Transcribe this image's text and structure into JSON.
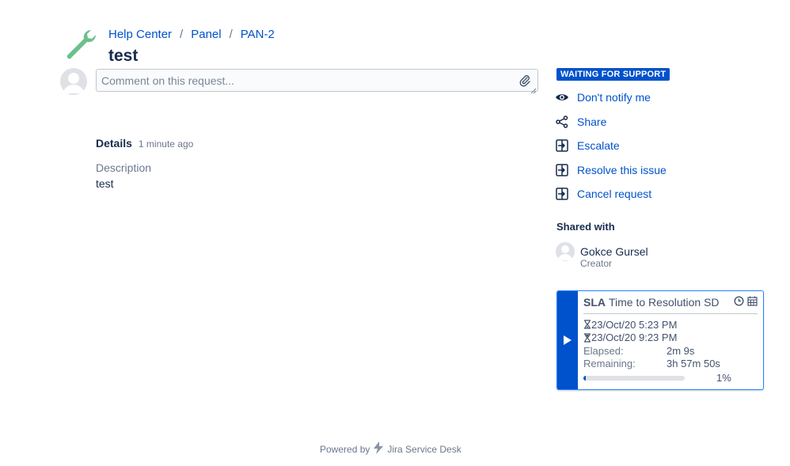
{
  "breadcrumb": {
    "items": [
      "Help Center",
      "Panel",
      "PAN-2"
    ],
    "separator": "/"
  },
  "page_title": "test",
  "comment": {
    "placeholder": "Comment on this request..."
  },
  "details": {
    "title": "Details",
    "time": "1 minute ago",
    "description_label": "Description",
    "description_value": "test"
  },
  "status": {
    "label": "WAITING FOR SUPPORT",
    "color": "#0052cc"
  },
  "actions": [
    {
      "label": "Don't notify me",
      "icon": "eye-icon"
    },
    {
      "label": "Share",
      "icon": "share-icon"
    },
    {
      "label": "Escalate",
      "icon": "transition-icon"
    },
    {
      "label": "Resolve this issue",
      "icon": "transition-icon"
    },
    {
      "label": "Cancel request",
      "icon": "transition-icon"
    }
  ],
  "shared_with": {
    "title": "Shared with",
    "user_name": "Gokce Gursel",
    "user_role": "Creator"
  },
  "sla": {
    "prefix": "SLA",
    "title": "Time to Resolution SD",
    "start": "23/Oct/20 5:23 PM",
    "due": "23/Oct/20 9:23 PM",
    "elapsed_label": "Elapsed:",
    "elapsed_value": "2m 9s",
    "remaining_label": "Remaining:",
    "remaining_value": "3h 57m 50s",
    "progress_percent": 1,
    "progress_label": "1%"
  },
  "footer": {
    "prefix": "Powered by",
    "product": "Jira Service Desk"
  },
  "colors": {
    "link": "#0052cc",
    "text": "#172b4d",
    "subtle": "#6b778c",
    "logo": "#57a55a"
  }
}
